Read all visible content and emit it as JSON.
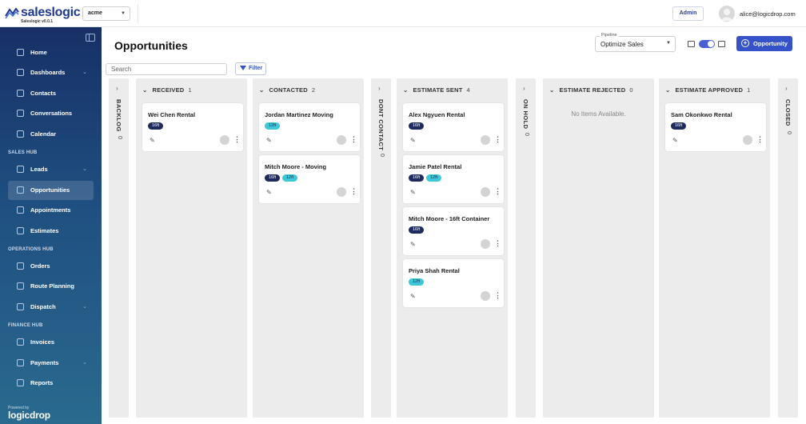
{
  "brand": {
    "name": "saleslogic",
    "version": "Saleslogic v0.0.1"
  },
  "org_select": {
    "value": "acme"
  },
  "header": {
    "admin_label": "Admin",
    "user_email": "alice@logicdrop.com"
  },
  "sidebar": {
    "items": [
      {
        "label": "Home"
      },
      {
        "label": "Dashboards"
      },
      {
        "label": "Contacts"
      },
      {
        "label": "Conversations"
      },
      {
        "label": "Calendar"
      },
      {
        "label": "Leads"
      },
      {
        "label": "Opportunities"
      },
      {
        "label": "Appointments"
      },
      {
        "label": "Estimates"
      },
      {
        "label": "Orders"
      },
      {
        "label": "Route Planning"
      },
      {
        "label": "Dispatch"
      },
      {
        "label": "Invoices"
      },
      {
        "label": "Payments"
      },
      {
        "label": "Reports"
      }
    ],
    "sections": [
      "SALES HUB",
      "OPERATIONS HUB",
      "FINANCE HUB"
    ],
    "powered_by": "Powered by",
    "powered_brand": "logicdrop"
  },
  "page": {
    "title": "Opportunities"
  },
  "pipeline": {
    "label": "Pipeline",
    "value": "Optimize Sales"
  },
  "toolbar": {
    "add_label": "Opportunity",
    "filter_label": "Filter",
    "search_placeholder": "Search"
  },
  "columns": {
    "backlog": {
      "title": "BACKLOG",
      "count": "0"
    },
    "received": {
      "title": "RECEIVED",
      "count": "1"
    },
    "contacted": {
      "title": "CONTACTED",
      "count": "2"
    },
    "dont_contact": {
      "title": "DONT CONTACT",
      "count": "0"
    },
    "estimate_sent": {
      "title": "ESTIMATE SENT",
      "count": "4"
    },
    "on_hold": {
      "title": "ON HOLD",
      "count": "0"
    },
    "estimate_rejected": {
      "title": "ESTIMATE REJECTED",
      "count": "0",
      "empty": "No Items Available."
    },
    "estimate_approved": {
      "title": "ESTIMATE APPROVED",
      "count": "1"
    },
    "closed": {
      "title": "CLOSED",
      "count": "0"
    }
  },
  "cards": {
    "wei": {
      "title": "Wei Chen Rental",
      "tags": [
        "16ft"
      ]
    },
    "jordan": {
      "title": "Jordan Martinez Moving",
      "tags": [
        "12ft"
      ]
    },
    "mitch_moving": {
      "title": "Mitch Moore - Moving",
      "tags": [
        "16ft",
        "12ft"
      ]
    },
    "alex": {
      "title": "Alex Ngyuen Rental",
      "tags": [
        "16ft"
      ]
    },
    "jamie": {
      "title": "Jamie Patel Rental",
      "tags": [
        "16ft",
        "12ft"
      ]
    },
    "mitch_container": {
      "title": "Mitch Moore - 16ft Container",
      "tags": [
        "16ft"
      ]
    },
    "priya": {
      "title": "Priya Shah Rental",
      "tags": [
        "12ft"
      ]
    },
    "sam": {
      "title": "Sam Okonkwo Rental",
      "tags": [
        "16ft"
      ]
    }
  },
  "colors": {
    "accent": "#3552c8",
    "tag_dark": "#1e2b5e",
    "tag_teal": "#3cc8d8",
    "sidebar": "#173066"
  }
}
